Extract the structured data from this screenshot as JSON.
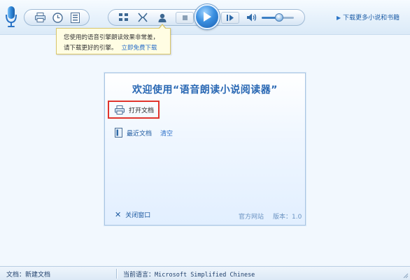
{
  "toolbar": {
    "mic_icon": "microphone-icon",
    "pill_a": [
      {
        "name": "print-button",
        "icon": "printer-icon"
      },
      {
        "name": "timer-button",
        "icon": "clock-icon"
      },
      {
        "name": "contents-button",
        "icon": "list-icon"
      }
    ],
    "pill_b": [
      {
        "name": "bookmark-button",
        "icon": "grid-icon"
      },
      {
        "name": "voice-button",
        "icon": "voice-icon"
      },
      {
        "name": "reader-button",
        "icon": "person-icon"
      }
    ],
    "playback": {
      "stop_icon": "stop-icon",
      "play_icon": "play-icon",
      "next_icon": "next-icon"
    },
    "volume": {
      "icon": "speaker-icon",
      "level": 0.55
    },
    "download_link": "下载更多小说和书籍",
    "colors": {
      "accent": "#2a6fc9",
      "play": "#3a8fe0"
    }
  },
  "tooltip": {
    "line1": "您使用的语音引擎朗读效果非常差，",
    "line2": "请下载更好的引擎。",
    "link": "立即免费下载"
  },
  "welcome": {
    "title": "欢迎使用“语音朗读小说阅读器”",
    "open_doc": "打开文档",
    "recent_docs": "最近文档",
    "clear": "清空",
    "close_window": "关闭窗口",
    "official_site": "官方网站",
    "version": "版本：1.0",
    "highlight_color": "#e0342c"
  },
  "status": {
    "doc_label": "文档：",
    "doc_value": "新建文档",
    "lang_label": "当前语言：",
    "lang_value": "Microsoft Simplified Chinese"
  }
}
